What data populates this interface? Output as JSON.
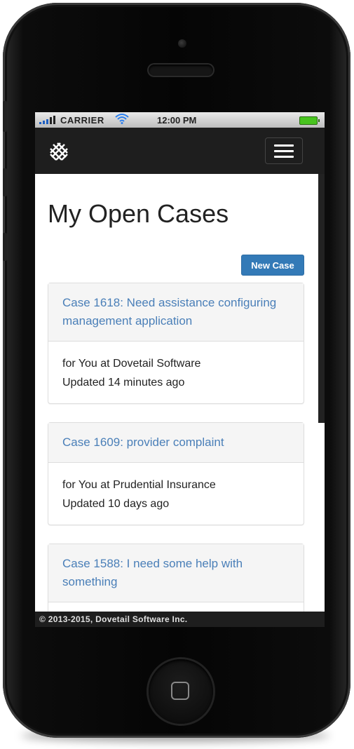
{
  "status_bar": {
    "carrier": "CARRIER",
    "time": "12:00 PM",
    "battery_color": "#48c41f"
  },
  "navbar": {
    "logo_icon": "dovetail-logo-icon",
    "menu_icon": "hamburger-menu-icon",
    "background": "#1e1e1e"
  },
  "page": {
    "title": "My Open Cases",
    "new_case_label": "New Case",
    "accent": "#337ab7",
    "link_color": "#4a7fb8"
  },
  "cases": [
    {
      "title": "Case 1618: Need assistance configuring management application",
      "owner_line": "for You at Dovetail Software",
      "updated_line": "Updated 14 minutes ago"
    },
    {
      "title": "Case 1609: provider complaint",
      "owner_line": "for You at Prudential Insurance",
      "updated_line": "Updated 10 days ago"
    },
    {
      "title": "Case 1588: I need some help with something"
    }
  ],
  "footer": {
    "copyright": "© 2013-2015, Dovetail Software Inc."
  }
}
